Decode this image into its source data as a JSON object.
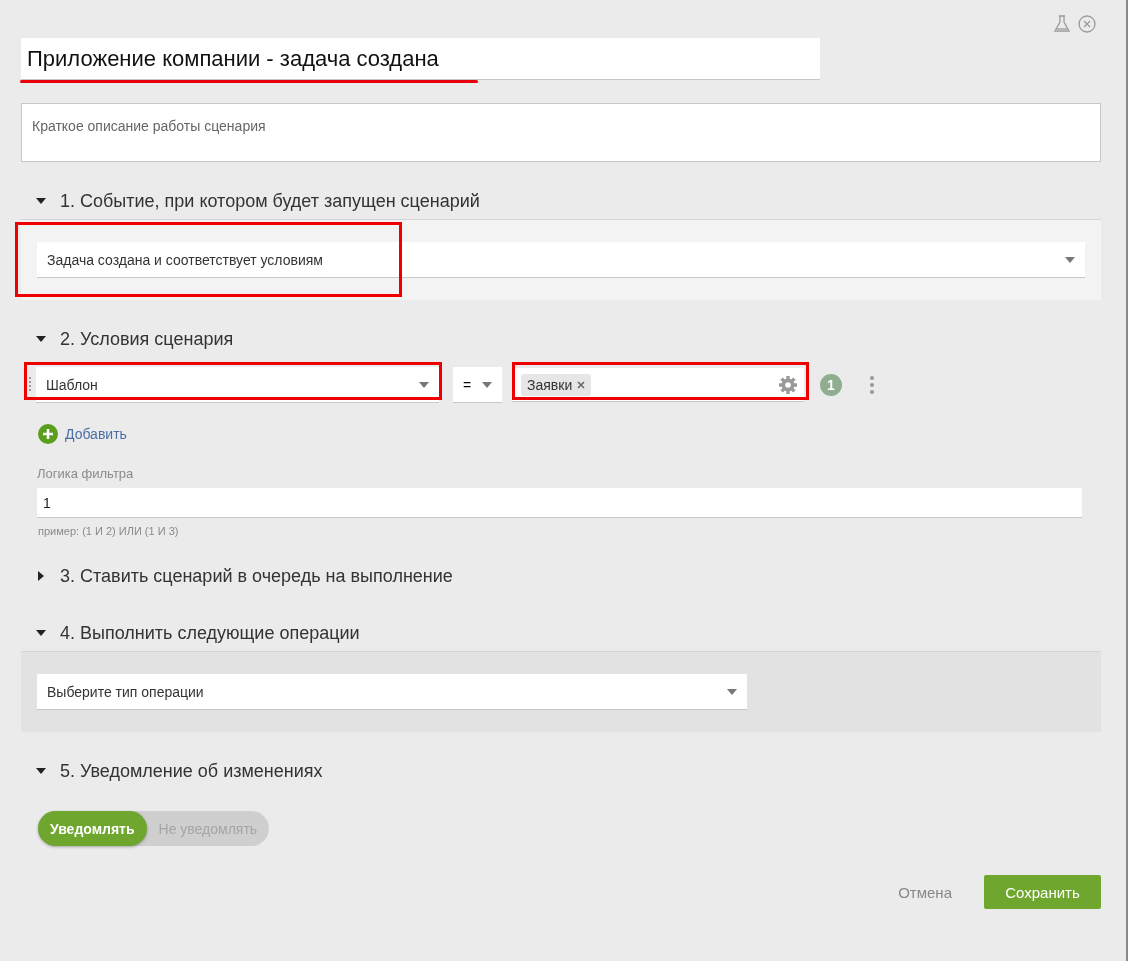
{
  "title": {
    "value": "Приложение компании - задача создана",
    "highlighted": true
  },
  "description": {
    "placeholder": "Краткое описание работы сценария"
  },
  "sections": [
    {
      "kind": "event",
      "title": "1. Событие, при котором будет запущен сценарий",
      "expanded": true,
      "select": {
        "value": "Задача создана и соответствует условиям",
        "highlighted": true
      }
    },
    {
      "kind": "conditions",
      "title": "2. Условия сценария",
      "expanded": true,
      "conditions": [
        {
          "field": "Шаблон",
          "field_highlighted": true,
          "operator": "=",
          "tags": [
            "Заявки"
          ],
          "value_highlighted": true,
          "badge": "1"
        }
      ],
      "add_label": "Добавить",
      "logic": {
        "label": "Логика фильтра",
        "value": "1",
        "hint": "пример: (1 И 2) ИЛИ (1 И 3)"
      }
    },
    {
      "kind": "queue",
      "title": "3. Ставить сценарий в очередь на выполнение",
      "expanded": false
    },
    {
      "kind": "operations",
      "title": "4. Выполнить следующие операции",
      "expanded": true,
      "select": {
        "value": "Выберите тип операции"
      }
    },
    {
      "kind": "notify",
      "title": "5. Уведомление об изменениях",
      "expanded": true,
      "options": [
        {
          "label": "Уведомлять",
          "selected": true
        },
        {
          "label": "Не уведомлять",
          "selected": false
        }
      ]
    }
  ],
  "buttons": [
    {
      "label": "Отмена",
      "kind": "link"
    },
    {
      "label": "Сохранить",
      "kind": "primary"
    }
  ]
}
